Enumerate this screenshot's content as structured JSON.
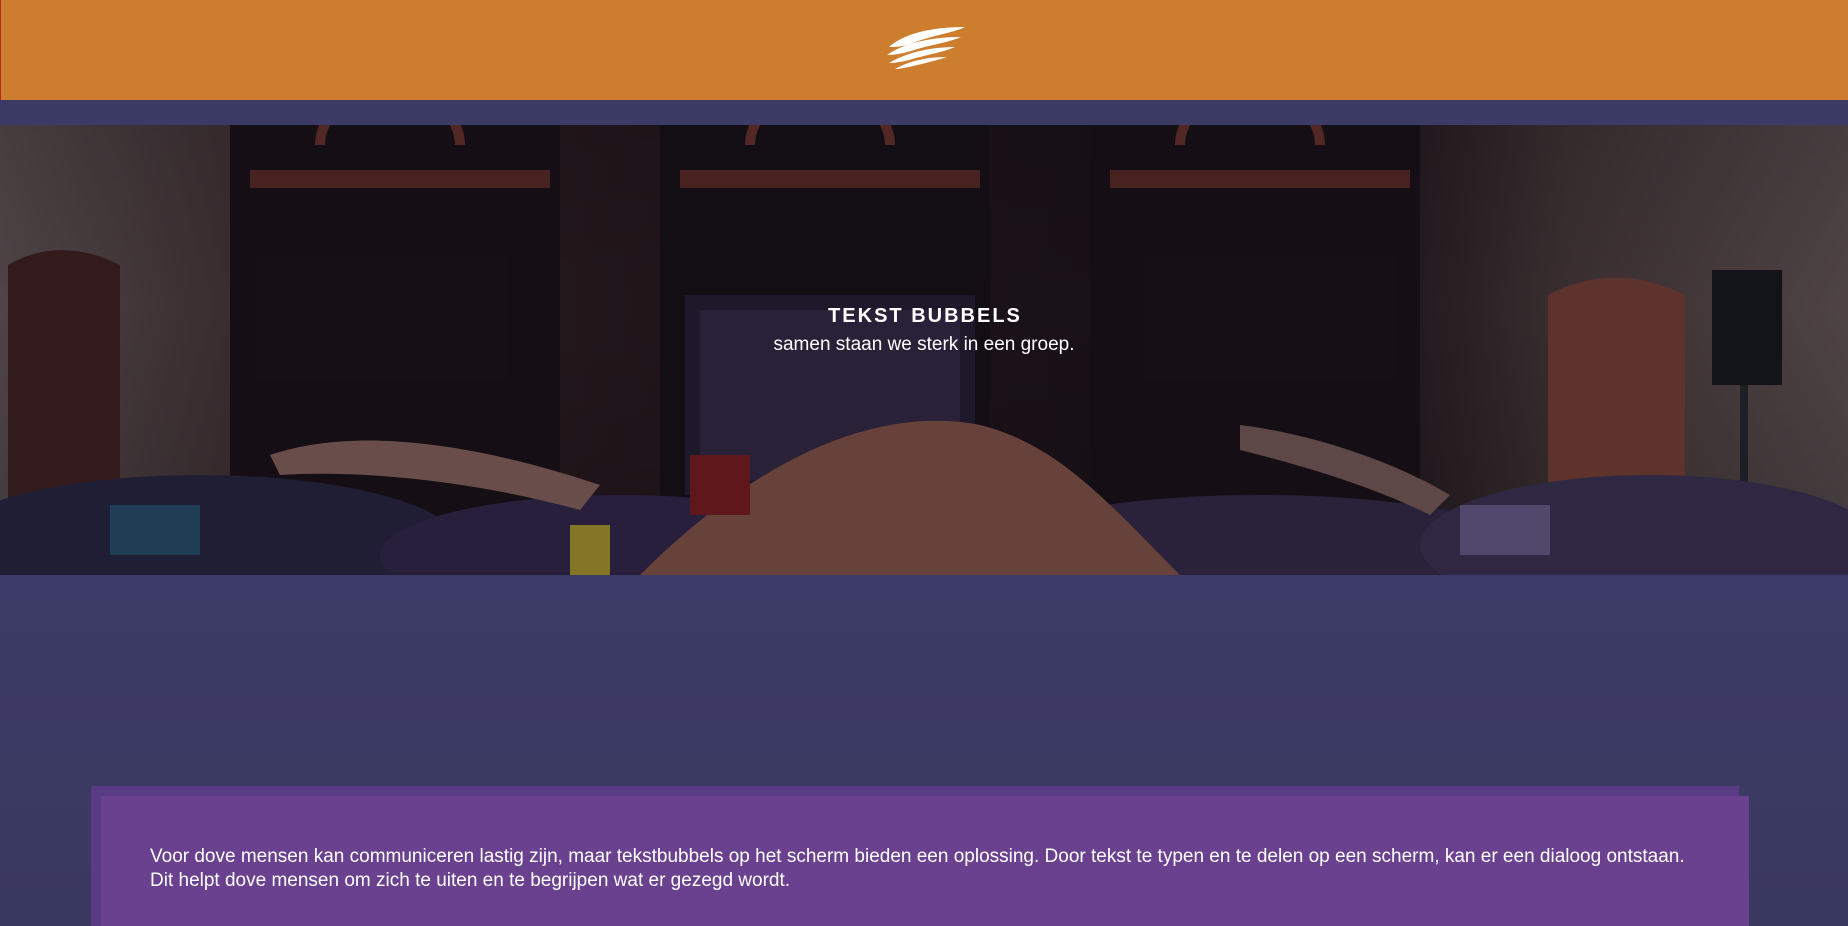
{
  "header": {
    "logo_icon": "wing-logo-icon",
    "background": "#cd7d2e"
  },
  "hero": {
    "title": "TEKST BUBBELS",
    "subtitle": "samen staan we sterk in een groep."
  },
  "intro": {
    "text": "Voor dove mensen kan communiceren lastig zijn, maar tekstbubbels op het scherm bieden een oplossing. Door tekst te typen en te delen op een scherm, kan er een dialoog ontstaan. Dit helpt dove mensen om zich te uiten en te begrijpen wat er gezegd wordt."
  },
  "colors": {
    "header": "#cd7d2e",
    "page": "#3b3b66",
    "card": "#6a418e"
  }
}
